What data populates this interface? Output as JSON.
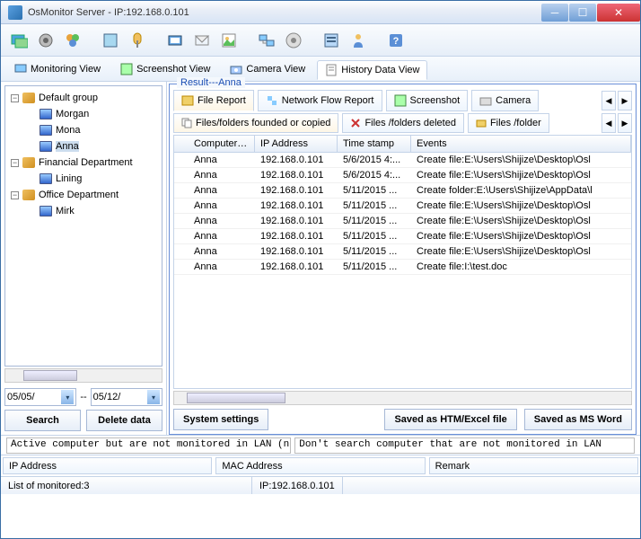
{
  "window": {
    "title": "OsMonitor Server -   IP:192.168.0.101"
  },
  "viewtabs": {
    "monitoring": "Monitoring View",
    "screenshot": "Screenshot View",
    "camera": "Camera View",
    "history": "History Data View"
  },
  "tree": {
    "groups": [
      {
        "name": "Default group",
        "children": [
          "Morgan",
          "Mona",
          "Anna"
        ]
      },
      {
        "name": "Financial Department",
        "children": [
          "Lining"
        ]
      },
      {
        "name": "Office Department",
        "children": [
          "Mirk"
        ]
      }
    ]
  },
  "dates": {
    "from": "05/05/",
    "sep": "--",
    "to": "05/12/"
  },
  "buttons": {
    "search": "Search",
    "delete": "Delete data"
  },
  "result": {
    "label": "Result---Anna",
    "tabs": {
      "file": "File Report",
      "net": "Network Flow Report",
      "ss": "Screenshot",
      "cam": "Camera"
    },
    "subtabs": {
      "found": "Files/folders founded or copied",
      "deleted": "Files /folders deleted",
      "more": "Files /folder"
    },
    "columns": {
      "c0": "Computer re...",
      "c1": "IP Address",
      "c2": "Time stamp",
      "c3": "Events"
    },
    "rows": [
      {
        "c0": "Anna",
        "c1": "192.168.0.101",
        "c2": "5/6/2015 4:...",
        "c3": "Create file:E:\\Users\\Shijize\\Desktop\\Osl"
      },
      {
        "c0": "Anna",
        "c1": "192.168.0.101",
        "c2": "5/6/2015 4:...",
        "c3": "Create file:E:\\Users\\Shijize\\Desktop\\Osl"
      },
      {
        "c0": "Anna",
        "c1": "192.168.0.101",
        "c2": "5/11/2015 ...",
        "c3": "Create folder:E:\\Users\\Shijize\\AppData\\l"
      },
      {
        "c0": "Anna",
        "c1": "192.168.0.101",
        "c2": "5/11/2015 ...",
        "c3": "Create file:E:\\Users\\Shijize\\Desktop\\Osl"
      },
      {
        "c0": "Anna",
        "c1": "192.168.0.101",
        "c2": "5/11/2015 ...",
        "c3": "Create file:E:\\Users\\Shijize\\Desktop\\Osl"
      },
      {
        "c0": "Anna",
        "c1": "192.168.0.101",
        "c2": "5/11/2015 ...",
        "c3": "Create file:E:\\Users\\Shijize\\Desktop\\Osl"
      },
      {
        "c0": "Anna",
        "c1": "192.168.0.101",
        "c2": "5/11/2015 ...",
        "c3": "Create file:E:\\Users\\Shijize\\Desktop\\Osl"
      },
      {
        "c0": "Anna",
        "c1": "192.168.0.101",
        "c2": "5/11/2015 ...",
        "c3": "Create file:I:\\test.doc"
      }
    ],
    "buttons": {
      "settings": "System settings",
      "htm": "Saved as HTM/Excel file",
      "word": "Saved as MS Word"
    }
  },
  "info": {
    "left": "Active computer but are not monitored in LAN (need run OsMon",
    "right": "Don't search computer that are not monitored in LAN"
  },
  "cols": {
    "ip": "IP Address",
    "mac": "MAC Address",
    "remark": "Remark"
  },
  "status": {
    "left": "List of monitored:3",
    "mid": "IP:192.168.0.101"
  }
}
